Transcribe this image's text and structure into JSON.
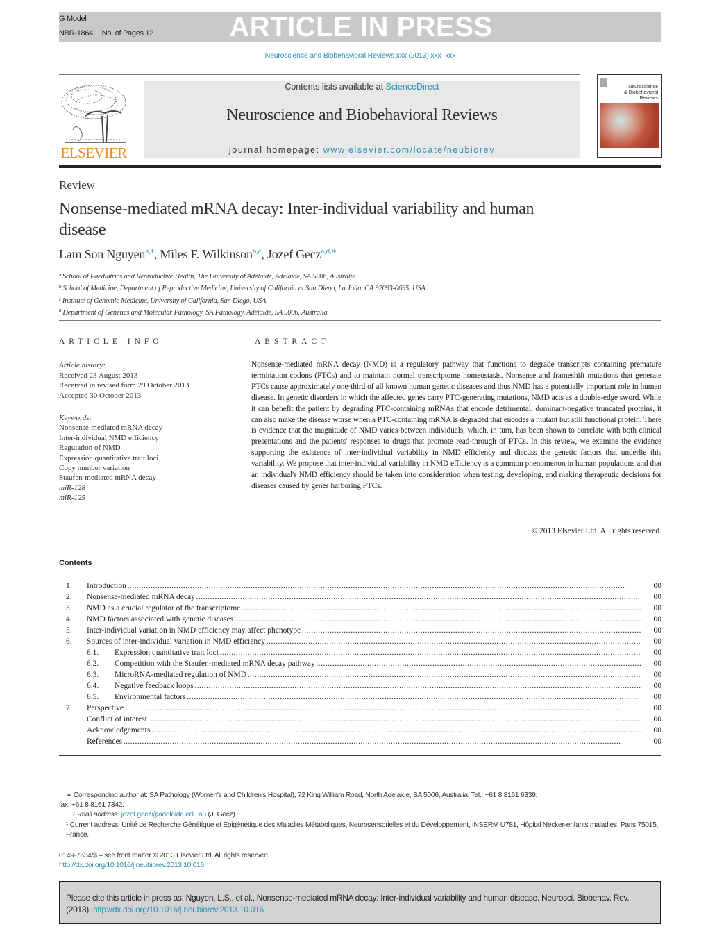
{
  "banner": {
    "g_model": "G Model",
    "manuscript_id": "NBR-1864;",
    "pages": "No. of Pages 12",
    "status": "ARTICLE IN PRESS",
    "running_citation": "Neuroscience and Biobehavioral Reviews xxx (2013) xxx–xxx"
  },
  "masthead": {
    "publisher_logo": "ELSEVIER",
    "contents_prefix": "Contents lists available at ",
    "contents_link": "ScienceDirect",
    "journal_name": "Neuroscience and Biobehavioral Reviews",
    "homepage_prefix": "journal homepage: ",
    "homepage_link": "www.elsevier.com/locate/neubiorev",
    "cover_title_lines": [
      "Neuroscience",
      "& Biobehavioral",
      "Reviews"
    ]
  },
  "article": {
    "type": "Review",
    "title": "Nonsense-mediated mRNA decay: Inter-individual variability and human disease",
    "authors": [
      {
        "name": "Lam Son Nguyen",
        "sup": "a,1"
      },
      {
        "name": "Miles F. Wilkinson",
        "sup": "b,c"
      },
      {
        "name": "Jozef Gecz",
        "sup": "a,d,∗"
      }
    ],
    "affiliations": [
      {
        "key": "a",
        "text": "School of Paediatrics and Reproductive Health, The University of Adelaide, Adelaide, SA 5006, Australia"
      },
      {
        "key": "b",
        "text": "School of Medicine, Department of Reproductive Medicine, University of California at San Diego, La Jolla, CA 92093-0695, USA"
      },
      {
        "key": "c",
        "text": "Institute of Genomic Medicine, University of California, San Diego, USA"
      },
      {
        "key": "d",
        "text": "Department of Genetics and Molecular Pathology, SA Pathology, Adelaide, SA 5006, Australia"
      }
    ]
  },
  "article_info": {
    "heading": "ARTICLE INFO",
    "history_label": "Article history:",
    "history": [
      "Received 23 August 2013",
      "Received in revised form 29 October 2013",
      "Accepted 30 October 2013"
    ],
    "keywords_label": "Keywords:",
    "keywords": [
      {
        "text": "Nonsense-mediated mRNA decay",
        "italic": false
      },
      {
        "text": "Inter-individual NMD efficiency",
        "italic": false
      },
      {
        "text": "Regulation of NMD",
        "italic": false
      },
      {
        "text": "Expression quantitative trait loci",
        "italic": false
      },
      {
        "text": "Copy number variation",
        "italic": false
      },
      {
        "text": "Staufen-mediated mRNA decay",
        "italic": false
      },
      {
        "text": "miR-128",
        "italic": true
      },
      {
        "text": "miR-125",
        "italic": true
      }
    ]
  },
  "abstract": {
    "heading": "ABSTRACT",
    "text": "Nonsense-mediated mRNA decay (NMD) is a regulatory pathway that functions to degrade transcripts containing premature termination codons (PTCs) and to maintain normal transcriptome homeostasis. Nonsense and frameshift mutations that generate PTCs cause approximately one-third of all known human genetic diseases and thus NMD has a potentially important role in human disease. In genetic disorders in which the affected genes carry PTC-generating mutations, NMD acts as a double-edge sword. While it can benefit the patient by degrading PTC-containing mRNAs that encode detrimental, dominant-negative truncated proteins, it can also make the disease worse when a PTC-containing mRNA is degraded that encodes a mutant but still functional protein. There is evidence that the magnitude of NMD varies between individuals, which, in turn, has been shown to correlate with both clinical presentations and the patients' responses to drugs that promote read-through of PTCs. In this review, we examine the evidence supporting the existence of inter-individual variability in NMD efficiency and discuss the genetic factors that underlie this variability. We propose that inter-individual variability in NMD efficiency is a common phenomenon in human populations and that an individual's NMD efficiency should be taken into consideration when testing, developing, and making therapeutic decisions for diseases caused by genes harboring PTCs.",
    "copyright": "© 2013 Elsevier Ltd. All rights reserved."
  },
  "contents": {
    "heading": "Contents",
    "items": [
      {
        "num": "1.",
        "title": "Introduction",
        "page": "00",
        "sub": false
      },
      {
        "num": "2.",
        "title": "Nonsense-mediated mRNA decay",
        "page": "00",
        "sub": false
      },
      {
        "num": "3.",
        "title": "NMD as a crucial regulator of the transcriptome",
        "page": "00",
        "sub": false
      },
      {
        "num": "4.",
        "title": "NMD factors associated with genetic diseases",
        "page": "00",
        "sub": false
      },
      {
        "num": "5.",
        "title": "Inter-individual variation in NMD efficiency may affect phenotype",
        "page": "00",
        "sub": false
      },
      {
        "num": "6.",
        "title": "Sources of inter-individual variation in NMD efficiency",
        "page": "00",
        "sub": false
      },
      {
        "num": "6.1.",
        "title": "Expression quantitative trait loci",
        "page": "00",
        "sub": true
      },
      {
        "num": "6.2.",
        "title": "Competition with the Staufen-mediated mRNA decay pathway",
        "page": "00",
        "sub": true
      },
      {
        "num": "6.3.",
        "title": "MicroRNA-mediated regulation of NMD",
        "page": "00",
        "sub": true
      },
      {
        "num": "6.4.",
        "title": "Negative feedback loops",
        "page": "00",
        "sub": true
      },
      {
        "num": "6.5.",
        "title": "Environmental factors",
        "page": "00",
        "sub": true
      },
      {
        "num": "7.",
        "title": "Perspective",
        "page": "00",
        "sub": false
      },
      {
        "num": "",
        "title": "Conflict of interest",
        "page": "00",
        "sub": false
      },
      {
        "num": "",
        "title": "Acknowledgements",
        "page": "00",
        "sub": false
      },
      {
        "num": "",
        "title": "References",
        "page": "00",
        "sub": false
      }
    ]
  },
  "footnotes": {
    "corresponding_line1": "∗ Corresponding author at: SA Pathology (Women's and Children's Hospital), 72 King William Road, North Adelaide, SA 5006, Australia. Tel.: +61 8 8161 6339;",
    "corresponding_line2": "fax: +61 8 8161 7342.",
    "email_label": "E-mail address: ",
    "email": "jozef.gecz@adelaide.edu.au",
    "email_suffix": " (J. Gecz).",
    "current_address": "¹ Current address: Unité de Recherche Génétique et Epigénétique des Maladies Métaboliques, Neurosensorielles et du Développement, INSERM U781, Hôpital Necker-enfants maladies, Paris 75015, France."
  },
  "front_matter": {
    "issn_line": "0149-7634/$ – see front matter © 2013 Elsevier Ltd. All rights reserved.",
    "doi": "http://dx.doi.org/10.1016/j.neubiorev.2013.10.016"
  },
  "citation": {
    "text": "Please cite this article in press as: Nguyen, L.S., et al., Nonsense-mediated mRNA decay: Inter-individual variability and human disease. Neurosci. Biobehav. Rev. (2013), ",
    "doi": "http://dx.doi.org/10.1016/j.neubiorev.2013.10.016"
  },
  "colors": {
    "link": "#2a8fb8",
    "elsevier_orange": "#f08a24",
    "banner_gray": "#c9c9c9",
    "masthead_gray": "#e8e8e8",
    "cite_box_gray": "#d3d3d3"
  }
}
